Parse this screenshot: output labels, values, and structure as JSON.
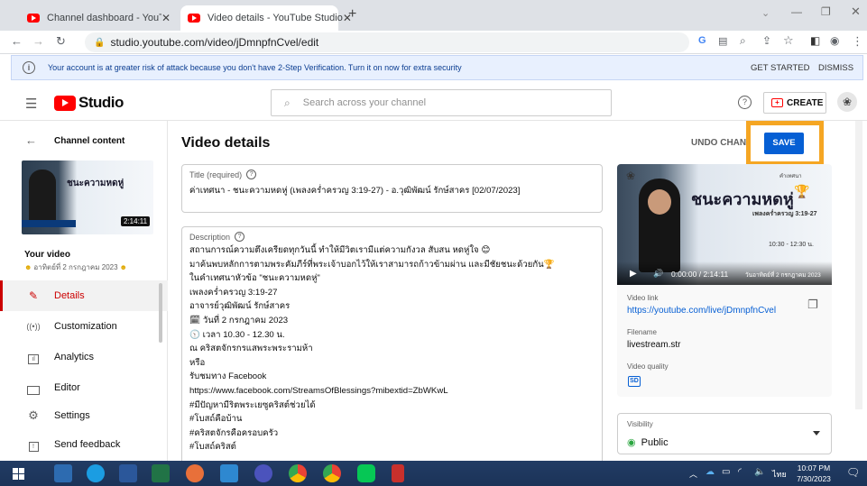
{
  "browser": {
    "tabs": [
      {
        "title": "Channel dashboard - YouTube St"
      },
      {
        "title": "Video details - YouTube Studio"
      }
    ],
    "url": "studio.youtube.com/video/jDmnpfnCvel/edit"
  },
  "banner": {
    "text": "Your account is at greater risk of attack because you don't have 2-Step Verification. Turn it on now for extra security",
    "get_started": "GET STARTED",
    "dismiss": "DISMISS"
  },
  "header": {
    "logo_text": "Studio",
    "search_placeholder": "Search across your channel",
    "create_label": "CREATE"
  },
  "sidebar": {
    "back_label": "Channel content",
    "thumb_duration": "2:14:11",
    "your_video_label": "Your video",
    "video_subtitle": "อาทิตย์ที่ 2 กรกฎาคม 2023",
    "items": [
      {
        "label": "Details",
        "icon": "pencil-icon"
      },
      {
        "label": "Customization",
        "icon": "broadcast-icon"
      },
      {
        "label": "Analytics",
        "icon": "analytics-icon"
      },
      {
        "label": "Editor",
        "icon": "editor-icon"
      },
      {
        "label": "Settings",
        "icon": "gear-icon"
      },
      {
        "label": "Send feedback",
        "icon": "feedback-icon"
      }
    ]
  },
  "main": {
    "page_title": "Video details",
    "undo_label": "UNDO CHANGES",
    "save_label": "SAVE",
    "title_label": "Title (required)",
    "title_value": "ค่าเทศนา - ชนะความหดหู่ (เพลงคร่ำครวญ 3:19-27) - อ.วุฒิพัฒน์ รักษ์สาคร [02/07/2023]",
    "description_label": "Description",
    "description_lines": [
      "สถานการณ์ความตึงเครียดทุกวันนี้ ทำให้มีวิตเรามีแต่ความกังวล สับสน หดหู่ใจ 😊",
      "มาค้นพบหลักการตามพระคัมภีร์ที่พระเจ้าบอกไว้ให้เราสามารถก้าวข้ามผ่าน และมีชัยชนะด้วยกัน🏆",
      "ในคำเทศนาหัวข้อ \"ชนะความหดหู่\"",
      "เพลงคร่ำครวญ 3:19-27",
      "อาจารย์วุฒิพัฒน์ รักษ์สาคร",
      "🗓 วันที่ 2 กรกฎาคม 2023",
      "🕥 เวลา 10.30 - 12.30 น.",
      "ณ คริสตจักรกรแสพระพระรามห้า",
      "หรือ",
      "รับชมทาง Facebook",
      "https://www.facebook.com/StreamsOfBlessings?mibextid=ZbWKwL",
      "#มีปัญหามีริตพระเยซูคริสต์ช่วยได้",
      "#โบสถ์คือบ้าน",
      "#คริสตจักรคือครอบครัว",
      "#โบสถ์คริสต์"
    ]
  },
  "preview": {
    "thumb_title": "ชนะความหดหู่",
    "thumb_sub": "เพลงคร่ำครวญ 3:19-27",
    "thumb_time": "10:30 - 12:30 น.",
    "thumb_date": "วันอาทิตย์ที่ 2 กรกฎาคม 2023",
    "thumb_badge": "คำเทศนา",
    "player_time": "0:00:00 / 2:14:11",
    "video_link_label": "Video link",
    "video_link": "https://youtube.com/live/jDmnpfnCvel",
    "filename_label": "Filename",
    "filename": "livestream.str",
    "quality_label": "Video quality",
    "quality_badge": "SD"
  },
  "visibility": {
    "label": "Visibility",
    "value": "Public"
  },
  "taskbar": {
    "time": "10:07 PM",
    "date": "7/30/2023",
    "lang": "ไทย"
  },
  "colors": {
    "accent_blue": "#065fd4",
    "highlight_orange": "#f5a623",
    "taskbar": "#1f3a60",
    "youtube_red": "#ff0000"
  }
}
